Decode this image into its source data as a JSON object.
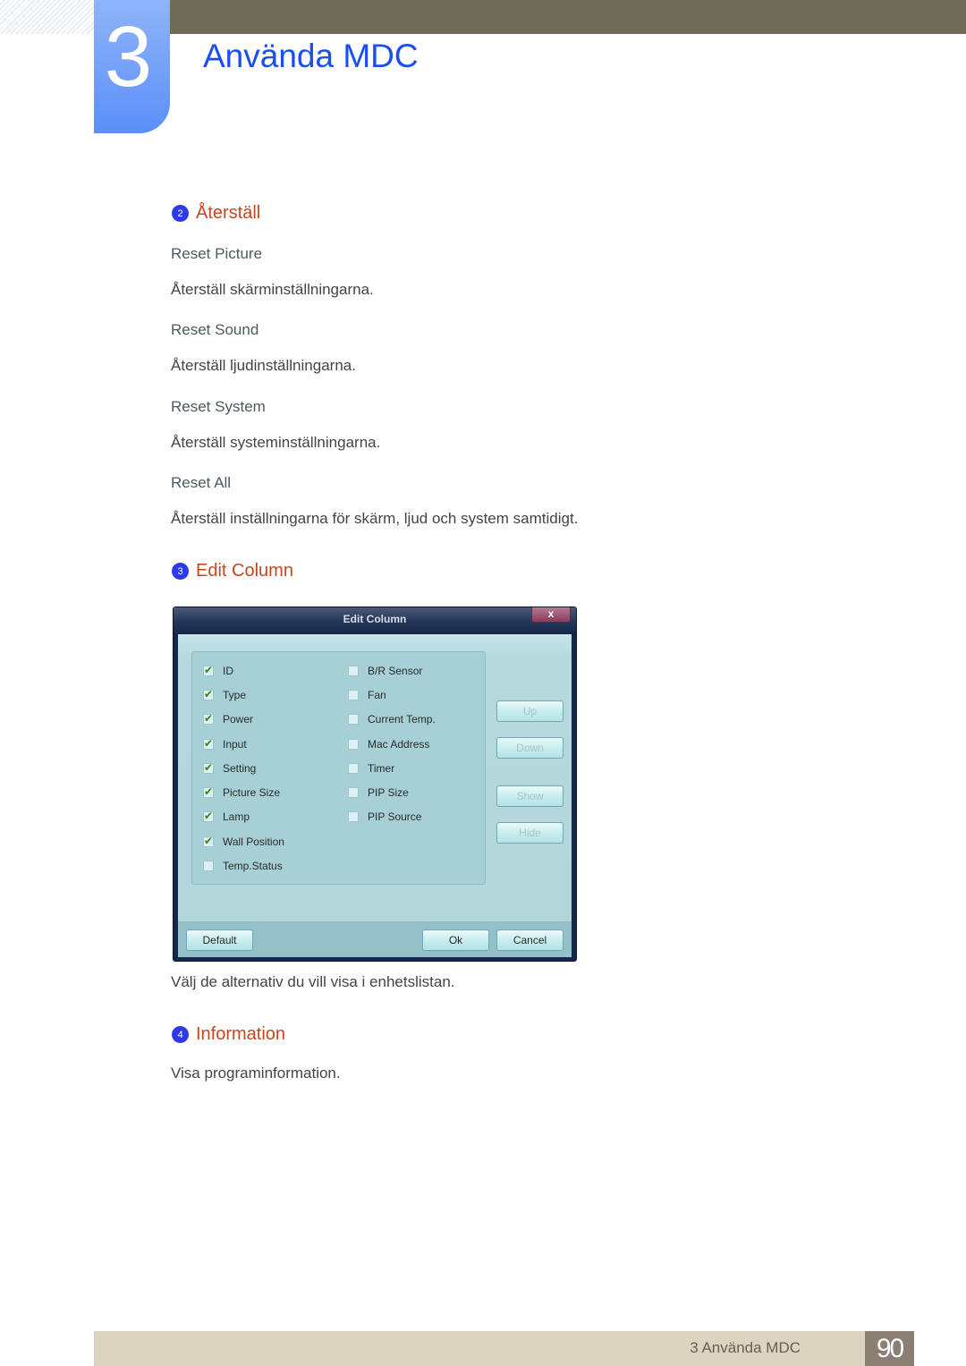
{
  "header": {
    "chapter_number": "3",
    "chapter_title": "Använda MDC"
  },
  "sections": [
    {
      "number": "2",
      "title": "Återställ",
      "items": [
        {
          "heading": "Reset Picture",
          "text": "Återställ skärminställningarna."
        },
        {
          "heading": "Reset Sound",
          "text": "Återställ ljudinställningarna."
        },
        {
          "heading": "Reset System",
          "text": "Återställ systeminställningarna."
        },
        {
          "heading": "Reset All",
          "text": "Återställ inställningarna för skärm, ljud och system samtidigt."
        }
      ]
    },
    {
      "number": "3",
      "title": "Edit Column",
      "caption": "Välj de alternativ du vill visa i enhetslistan."
    },
    {
      "number": "4",
      "title": "Information",
      "text": "Visa programinformation."
    }
  ],
  "dialog": {
    "title": "Edit Column",
    "close_label": "x",
    "left_column": [
      {
        "label": "ID",
        "checked": true
      },
      {
        "label": "Type",
        "checked": true
      },
      {
        "label": "Power",
        "checked": true
      },
      {
        "label": "Input",
        "checked": true
      },
      {
        "label": "Setting",
        "checked": true
      },
      {
        "label": "Picture Size",
        "checked": true
      },
      {
        "label": "Lamp",
        "checked": true
      },
      {
        "label": "Wall Position",
        "checked": true
      },
      {
        "label": "Temp.Status",
        "checked": false
      }
    ],
    "right_column": [
      {
        "label": "B/R Sensor",
        "checked": false
      },
      {
        "label": "Fan",
        "checked": false
      },
      {
        "label": "Current Temp.",
        "checked": false
      },
      {
        "label": "Mac Address",
        "checked": false
      },
      {
        "label": "Timer",
        "checked": false
      },
      {
        "label": "PIP Size",
        "checked": false
      },
      {
        "label": "PIP Source",
        "checked": false
      }
    ],
    "side_buttons": {
      "up": "Up",
      "down": "Down",
      "show": "Show",
      "hide": "Hide"
    },
    "footer_buttons": {
      "default": "Default",
      "ok": "Ok",
      "cancel": "Cancel"
    }
  },
  "footer": {
    "label": "3 Använda MDC",
    "page_number": "90"
  }
}
